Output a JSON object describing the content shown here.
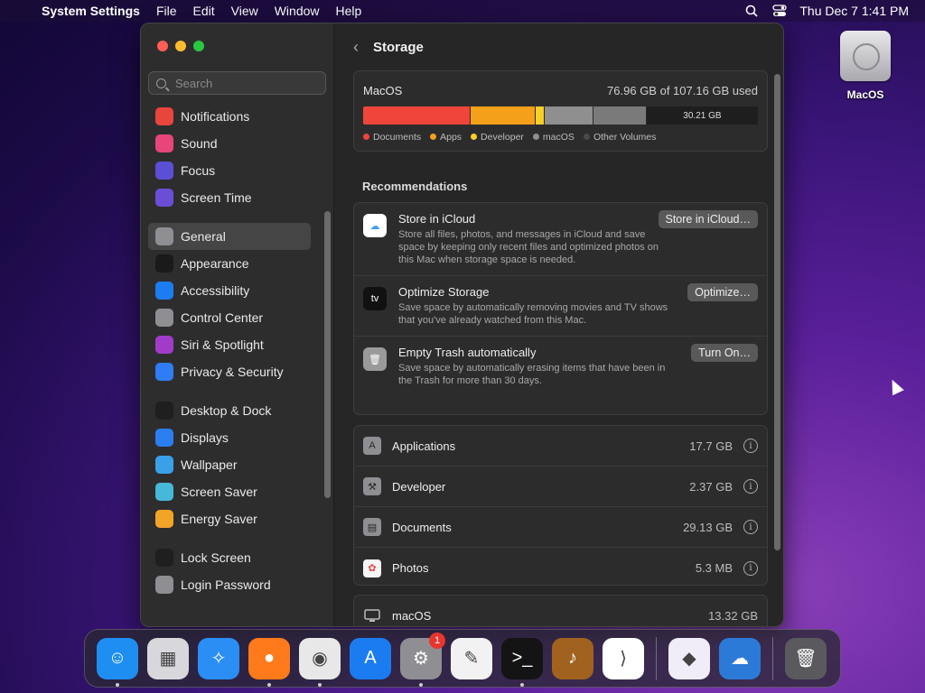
{
  "menubar": {
    "app": "System Settings",
    "menus": [
      "File",
      "Edit",
      "View",
      "Window",
      "Help"
    ],
    "clock": "Thu Dec 7  1:41 PM"
  },
  "desktop": {
    "drive_label": "MacOS"
  },
  "sidebar": {
    "search_placeholder": "Search",
    "groups": [
      [
        {
          "label": "Notifications",
          "icon": "bell-icon",
          "color": "#e8453c"
        },
        {
          "label": "Sound",
          "icon": "speaker-icon",
          "color": "#e8457a"
        },
        {
          "label": "Focus",
          "icon": "moon-icon",
          "color": "#5b4fd6"
        },
        {
          "label": "Screen Time",
          "icon": "hourglass-icon",
          "color": "#6a4fd6"
        }
      ],
      [
        {
          "label": "General",
          "icon": "gear-icon",
          "color": "#8e8e93",
          "selected": true
        },
        {
          "label": "Appearance",
          "icon": "appearance-icon",
          "color": "#1a1a1a"
        },
        {
          "label": "Accessibility",
          "icon": "accessibility-icon",
          "color": "#1c7cf2"
        },
        {
          "label": "Control Center",
          "icon": "control-center-icon",
          "color": "#8e8e93"
        },
        {
          "label": "Siri & Spotlight",
          "icon": "siri-icon",
          "color": "#a03cc8"
        },
        {
          "label": "Privacy & Security",
          "icon": "hand-icon",
          "color": "#2f7cf6"
        }
      ],
      [
        {
          "label": "Desktop & Dock",
          "icon": "dock-icon",
          "color": "#1f1f1f"
        },
        {
          "label": "Displays",
          "icon": "sun-icon",
          "color": "#2a7ef0"
        },
        {
          "label": "Wallpaper",
          "icon": "flower-icon",
          "color": "#3aa0e8"
        },
        {
          "label": "Screen Saver",
          "icon": "screen-saver-icon",
          "color": "#46b8d8"
        },
        {
          "label": "Energy Saver",
          "icon": "battery-icon",
          "color": "#f2a428"
        }
      ],
      [
        {
          "label": "Lock Screen",
          "icon": "lock-icon",
          "color": "#1f1f1f"
        },
        {
          "label": "Login Password",
          "icon": "lock-icon",
          "color": "#8e8e93"
        }
      ]
    ]
  },
  "main": {
    "title": "Storage",
    "volume": {
      "name": "MacOS",
      "used_text": "76.96 GB of 107.16 GB used",
      "free_text": "30.21 GB",
      "segments": [
        {
          "name": "Documents",
          "color": "#f0453b",
          "gb": 29.13
        },
        {
          "name": "Apps",
          "color": "#f5a01a",
          "gb": 17.7
        },
        {
          "name": "Developer",
          "color": "#f6cf27",
          "gb": 2.37
        },
        {
          "name": "macOS",
          "color": "#8f8f8f",
          "gb": 13.32
        },
        {
          "name": "Other Volumes",
          "color": "#7a7a7a",
          "gb": 14.44
        }
      ],
      "total_gb": 107.16
    },
    "recommendations_label": "Recommendations",
    "recommendations": [
      {
        "title": "Store in iCloud",
        "desc": "Store all files, photos, and messages in iCloud and save space by keeping only recent files and optimized photos on this Mac when storage space is needed.",
        "button": "Store in iCloud…",
        "icon": "icloud-icon",
        "color": "#ffffff"
      },
      {
        "title": "Optimize Storage",
        "desc": "Save space by automatically removing movies and TV shows that you've already watched from this Mac.",
        "button": "Optimize…",
        "icon": "appletv-icon",
        "color": "#111111"
      },
      {
        "title": "Empty Trash automatically",
        "desc": "Save space by automatically erasing items that have been in the Trash for more than 30 days.",
        "button": "Turn On…",
        "icon": "trash-icon",
        "color": "#9a9a9a"
      }
    ],
    "categories": [
      {
        "name": "Applications",
        "size": "17.7 GB",
        "icon": "applications-icon"
      },
      {
        "name": "Developer",
        "size": "2.37 GB",
        "icon": "developer-icon"
      },
      {
        "name": "Documents",
        "size": "29.13 GB",
        "icon": "documents-icon"
      },
      {
        "name": "Photos",
        "size": "5.3 MB",
        "icon": "photos-icon"
      }
    ],
    "system_row": {
      "name": "macOS",
      "size": "13.32 GB"
    }
  },
  "dock": {
    "apps": [
      {
        "name": "finder",
        "color": "#1e8ef2",
        "glyph": "☺",
        "running": true
      },
      {
        "name": "launchpad",
        "color": "#d8d8dc",
        "glyph": "▦",
        "running": false
      },
      {
        "name": "safari",
        "color": "#2a8ef5",
        "glyph": "✧",
        "running": false
      },
      {
        "name": "firefox",
        "color": "#ff7a1a",
        "glyph": "●",
        "running": true
      },
      {
        "name": "chrome",
        "color": "#e8e8e8",
        "glyph": "◉",
        "running": true
      },
      {
        "name": "app-store",
        "color": "#1b7cf2",
        "glyph": "A",
        "running": false
      },
      {
        "name": "system-settings",
        "color": "#8e8e93",
        "glyph": "⚙",
        "running": true,
        "badge": "1"
      },
      {
        "name": "textedit",
        "color": "#f2f2f2",
        "glyph": "✎",
        "running": false
      },
      {
        "name": "terminal",
        "color": "#141414",
        "glyph": ">_",
        "running": true
      },
      {
        "name": "garageband",
        "color": "#a0621e",
        "glyph": "♪",
        "running": false
      },
      {
        "name": "vscode",
        "color": "#ffffff",
        "glyph": "⟩",
        "running": false
      }
    ],
    "recent": [
      {
        "name": "visual-studio",
        "color": "#f0ecf8",
        "glyph": "◆"
      },
      {
        "name": "weather",
        "color": "#2b7ad8",
        "glyph": "☁"
      }
    ],
    "trash": {
      "name": "trash",
      "color": "#5a5a5e",
      "glyph": "🗑"
    }
  }
}
